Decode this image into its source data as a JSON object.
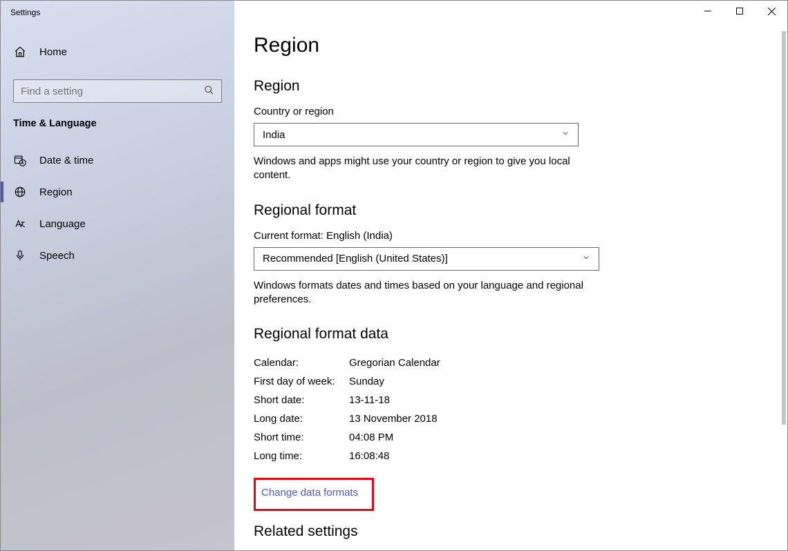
{
  "window": {
    "title": "Settings"
  },
  "search": {
    "placeholder": "Find a setting"
  },
  "sidebar": {
    "home": "Home",
    "category": "Time & Language",
    "items": [
      {
        "label": "Date & time"
      },
      {
        "label": "Region"
      },
      {
        "label": "Language"
      },
      {
        "label": "Speech"
      }
    ]
  },
  "page": {
    "title": "Region",
    "region_header": "Region",
    "country_label": "Country or region",
    "country_value": "India",
    "country_helper": "Windows and apps might use your country or region to give you local content.",
    "regional_format_header": "Regional format",
    "current_format_label": "Current format: English (India)",
    "format_value": "Recommended [English (United States)]",
    "format_helper": "Windows formats dates and times based on your language and regional preferences.",
    "format_data_header": "Regional format data",
    "rows": [
      {
        "k": "Calendar:",
        "v": "Gregorian Calendar"
      },
      {
        "k": "First day of week:",
        "v": "Sunday"
      },
      {
        "k": "Short date:",
        "v": "13-11-18"
      },
      {
        "k": "Long date:",
        "v": "13 November 2018"
      },
      {
        "k": "Short time:",
        "v": "04:08 PM"
      },
      {
        "k": "Long time:",
        "v": "16:08:48"
      }
    ],
    "change_link": "Change data formats",
    "related_header": "Related settings"
  }
}
